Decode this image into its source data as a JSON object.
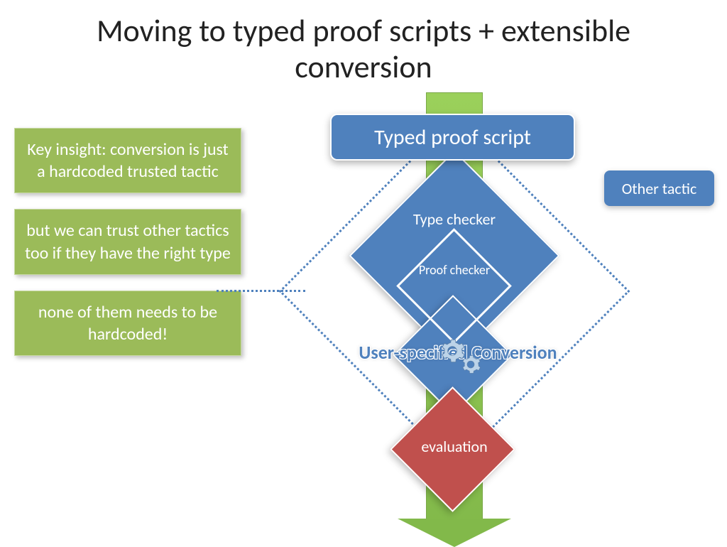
{
  "title": "Moving to typed proof scripts + extensible conversion",
  "left": {
    "box1": "Key insight: conversion is just a hardcoded trusted tactic",
    "box2": "but we can trust other tactics too if they have the right type",
    "box3": "none of them needs to be hardcoded!"
  },
  "flow": {
    "top": "Typed proof script",
    "other_tactic": "Other tactic",
    "type_checker": "Type checker",
    "proof_checker": "Proof checker",
    "conversion": "User-specified Conversion",
    "evaluation": "evaluation"
  }
}
